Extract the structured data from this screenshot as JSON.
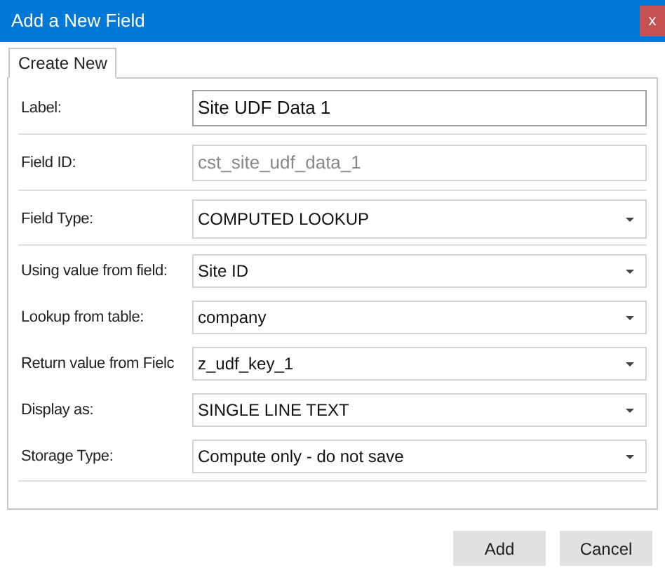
{
  "window": {
    "title": "Add a New Field",
    "close": "x"
  },
  "tabs": [
    {
      "label": "Create New",
      "selected": true
    }
  ],
  "sections": [
    {
      "rows": [
        {
          "label": "Label:",
          "kind": "text",
          "value": "Site UDF Data 1"
        }
      ]
    },
    {
      "rows": [
        {
          "label": "Field ID:",
          "kind": "readonly",
          "value": "cst_site_udf_data_1"
        }
      ]
    },
    {
      "rows": [
        {
          "label": "Field Type:",
          "kind": "dropdown",
          "value": "COMPUTED LOOKUP"
        }
      ]
    },
    {
      "rows": [
        {
          "label": "Using value from field:",
          "kind": "dropdown",
          "value": "Site ID"
        },
        {
          "label": "Lookup from table:",
          "kind": "dropdown",
          "value": "company"
        },
        {
          "label": "Return value from Fielc",
          "kind": "dropdown",
          "value": "z_udf_key_1"
        },
        {
          "label": "Display as:",
          "kind": "dropdown",
          "value": "SINGLE LINE TEXT"
        },
        {
          "label": "Storage Type:",
          "kind": "dropdown",
          "value": "Compute only - do not save"
        }
      ]
    }
  ],
  "buttons": [
    "Add",
    "Cancel"
  ]
}
